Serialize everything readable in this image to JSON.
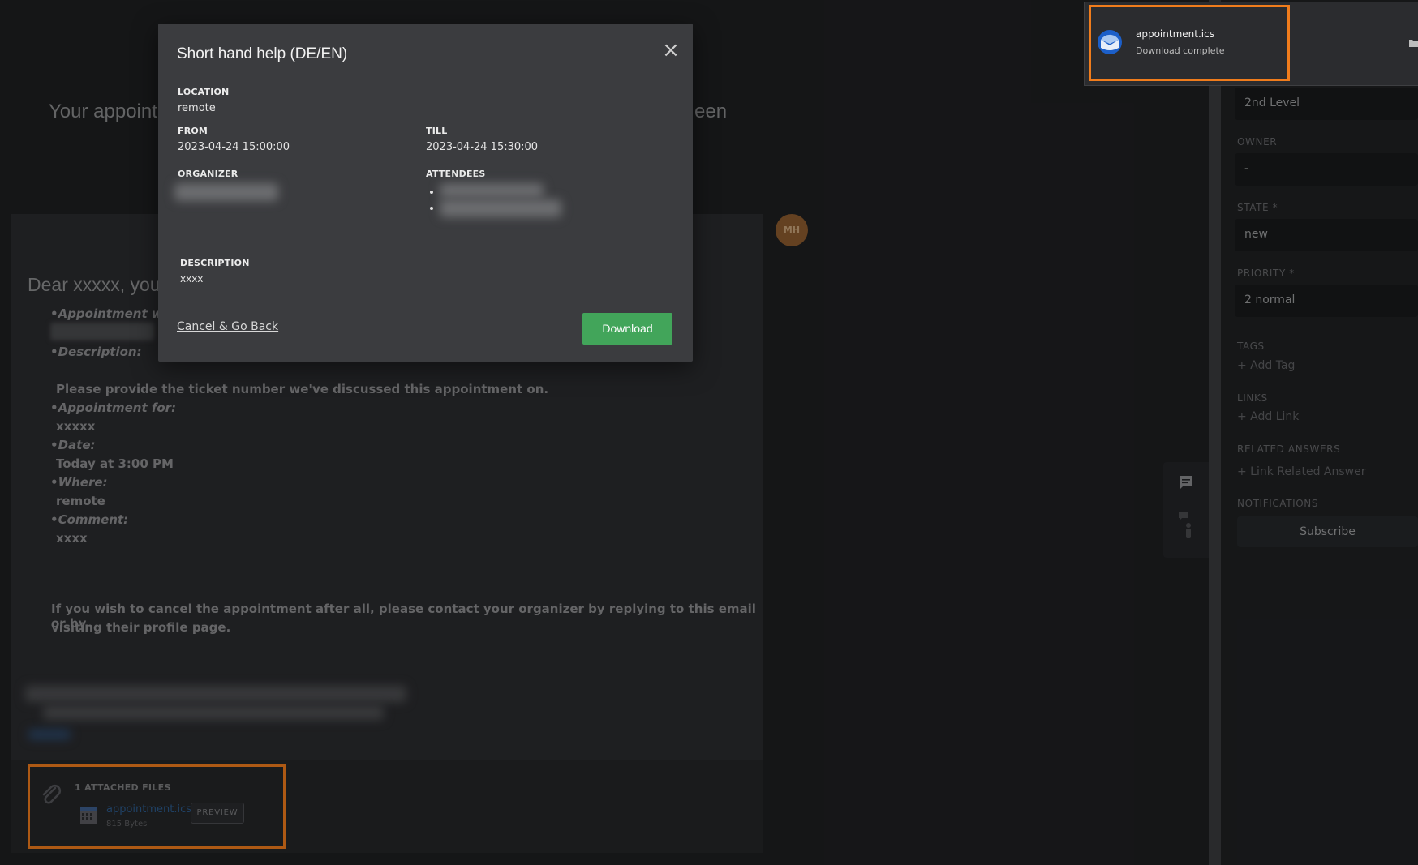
{
  "page": {
    "headline_start": "Your appoint",
    "headline_end": "een",
    "greeting": "Dear xxxxx, you"
  },
  "email": {
    "appointment_with_label": "•Appointment wit",
    "description_label": "•Description:",
    "description_text": "Please provide the ticket number we've discussed this appointment on.",
    "appointment_for_label": "•Appointment for:",
    "appointment_for_value": "xxxxx",
    "date_label": "•Date:",
    "date_value": "Today at 3:00 PM",
    "where_label": "•Where:",
    "where_value": "remote",
    "comment_label": "•Comment:",
    "comment_value": "xxxx",
    "cancel_line1": "If you wish to cancel the appointment after all, please contact your organizer by replying to this email or by",
    "cancel_line2": "visiting their profile page."
  },
  "attachments": {
    "title": "1 ATTACHED FILES",
    "files": [
      {
        "name": "appointment.ics",
        "size": "815 Bytes"
      }
    ],
    "preview_label": "PREVIEW"
  },
  "avatar": {
    "initials": "MH",
    "color": "#8b5a2e"
  },
  "modal": {
    "title": "Short hand help (DE/EN)",
    "location_label": "LOCATION",
    "location_value": "remote",
    "from_label": "FROM",
    "from_value": "2023-04-24 15:00:00",
    "till_label": "TILL",
    "till_value": "2023-04-24 15:30:00",
    "organizer_label": "ORGANIZER",
    "attendees_label": "ATTENDEES",
    "description_label": "DESCRIPTION",
    "description_value": "xxxx",
    "cancel_label": "Cancel & Go Back",
    "download_label": "Download"
  },
  "sidebar": {
    "group_value": "2nd Level",
    "owner_label": "OWNER",
    "owner_value": "-",
    "state_label": "STATE *",
    "state_value": "new",
    "priority_label": "PRIORITY *",
    "priority_value": "2 normal",
    "tags_label": "TAGS",
    "add_tag": "+ Add Tag",
    "links_label": "LINKS",
    "add_link": "+ Add Link",
    "related_label": "RELATED ANSWERS",
    "link_related": "+ Link Related Answer",
    "notifications_label": "NOTIFICATIONS",
    "subscribe_label": "Subscribe"
  },
  "notification": {
    "file_name": "appointment.ics",
    "status": "Download complete"
  },
  "colors": {
    "highlight": "#f07c1c",
    "download_button": "#42a55a",
    "modal_bg": "#3b3c3f"
  }
}
